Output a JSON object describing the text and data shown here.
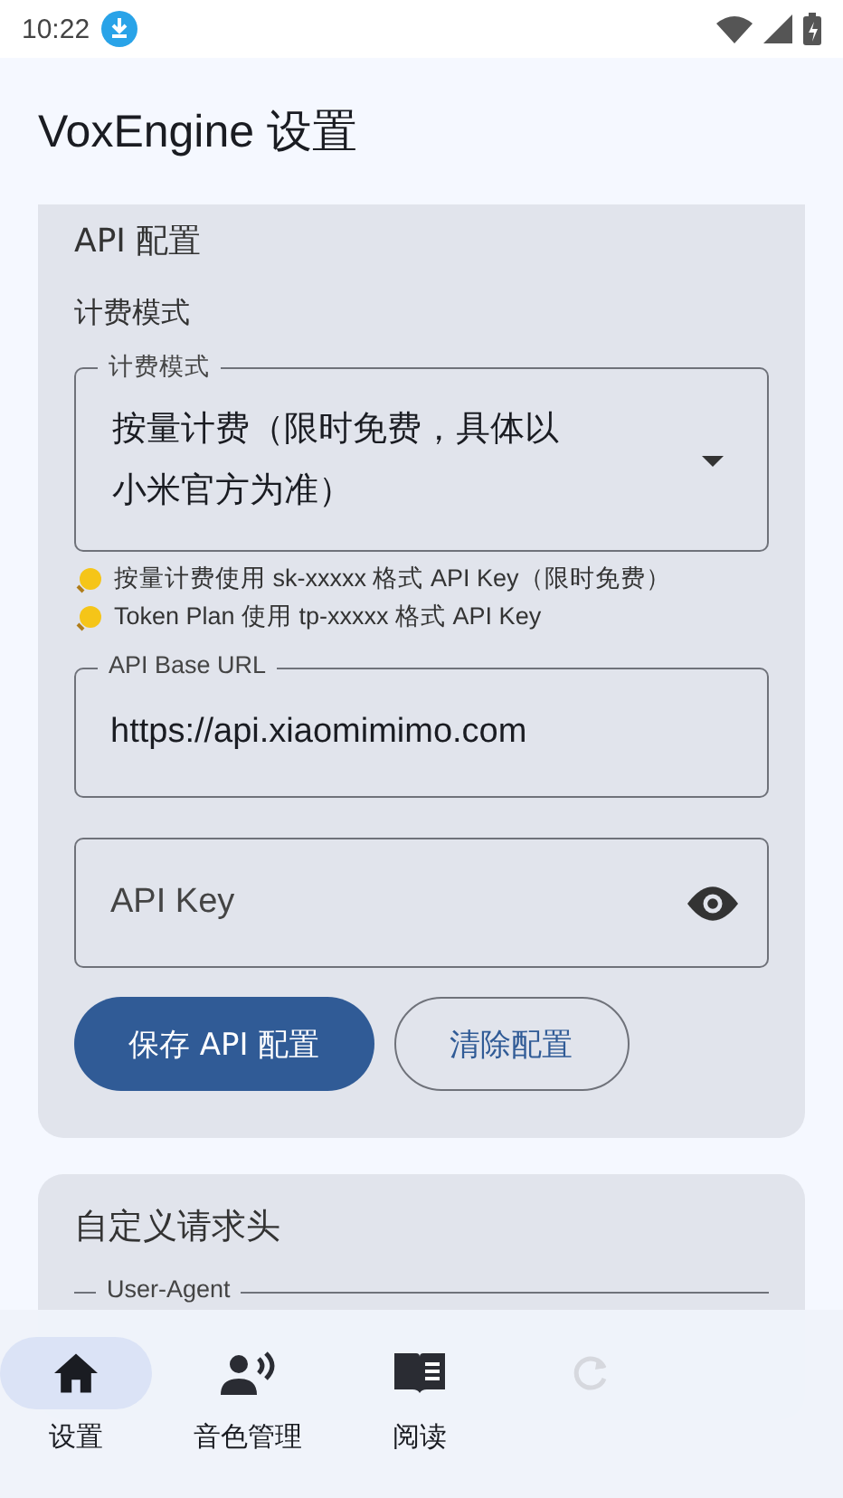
{
  "status_bar": {
    "time": "10:22"
  },
  "title": "VoxEngine 设置",
  "api_card": {
    "title": "API 配置",
    "billing_label": "计费模式",
    "billing_select": {
      "label": "计费模式",
      "value": "按量计费（限时免费，具体以小米官方为准）"
    },
    "hints": [
      "按量计费使用 sk-xxxxx 格式 API Key（限时免费）",
      "Token Plan 使用 tp-xxxxx 格式 API Key"
    ],
    "base_url": {
      "label": "API Base URL",
      "value": "https://api.xiaomimimo.com"
    },
    "api_key": {
      "placeholder": "API Key"
    },
    "buttons": [
      {
        "label": "保存 API 配置",
        "kind": "filled"
      },
      {
        "label": "清除配置",
        "kind": "outlined"
      }
    ]
  },
  "headers_card": {
    "title": "自定义请求头",
    "user_agent_label": "User-Agent"
  },
  "nav": [
    {
      "label": "设置",
      "selected": true
    },
    {
      "label": "音色管理",
      "selected": false
    },
    {
      "label": "阅读",
      "selected": false
    },
    {
      "selected": false
    }
  ]
}
